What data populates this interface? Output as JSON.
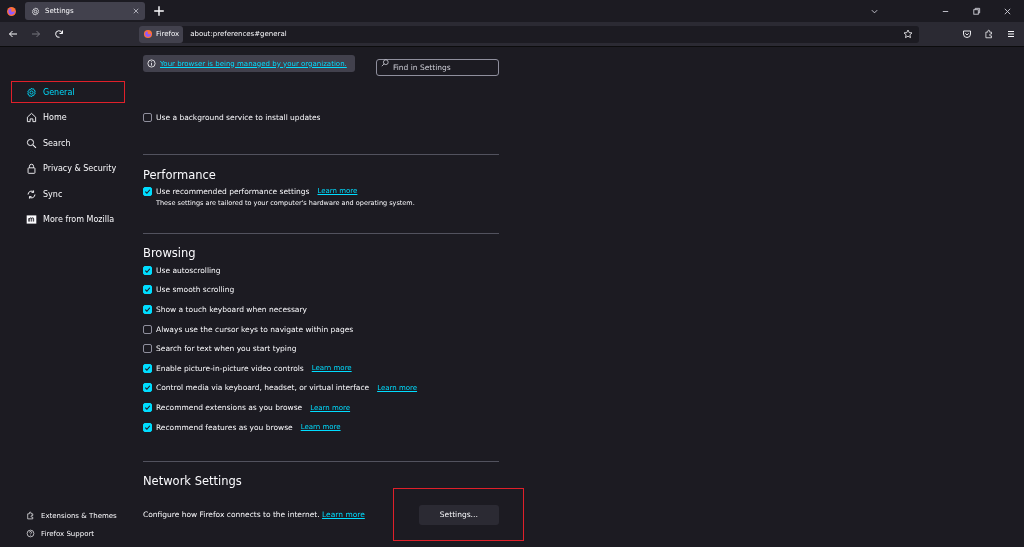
{
  "browser": {
    "tab": {
      "title": "Settings",
      "selected": true
    },
    "identity_label": "Firefox",
    "url": "about:preferences#general"
  },
  "sidebar": {
    "items": [
      {
        "label": "General",
        "selected": true,
        "highlighted": true
      },
      {
        "label": "Home",
        "selected": false,
        "highlighted": false
      },
      {
        "label": "Search",
        "selected": false,
        "highlighted": false
      },
      {
        "label": "Privacy & Security",
        "selected": false,
        "highlighted": false
      },
      {
        "label": "Sync",
        "selected": false,
        "highlighted": false
      },
      {
        "label": "More from Mozilla",
        "selected": false,
        "highlighted": false
      }
    ],
    "footer": [
      {
        "label": "Extensions & Themes"
      },
      {
        "label": "Firefox Support"
      }
    ]
  },
  "notice": "Your browser is being managed by your organization.",
  "search": {
    "placeholder": "Find in Settings"
  },
  "update_option": {
    "label": "Use a background service to install updates",
    "checked": false
  },
  "sections": [
    {
      "title": "Performance",
      "options": [
        {
          "label": "Use recommended performance settings",
          "checked": true,
          "link": "Learn more"
        }
      ],
      "note": "These settings are tailored to your computer's hardware and operating system."
    },
    {
      "title": "Browsing",
      "options": [
        {
          "label": "Use autoscrolling",
          "checked": true
        },
        {
          "label": "Use smooth scrolling",
          "checked": true
        },
        {
          "label": "Show a touch keyboard when necessary",
          "checked": true
        },
        {
          "label": "Always use the cursor keys to navigate within pages",
          "checked": false
        },
        {
          "label": "Search for text when you start typing",
          "checked": false
        },
        {
          "label": "Enable picture-in-picture video controls",
          "checked": true,
          "link": "Learn more"
        },
        {
          "label": "Control media via keyboard, headset, or virtual interface",
          "checked": true,
          "link": "Learn more"
        },
        {
          "label": "Recommend extensions as you browse",
          "checked": true,
          "link": "Learn more"
        },
        {
          "label": "Recommend features as you browse",
          "checked": true,
          "link": "Learn more"
        }
      ]
    }
  ],
  "network": {
    "title": "Network Settings",
    "description": "Configure how Firefox connects to the internet.",
    "link": "Learn more",
    "button": "Settings…",
    "highlighted": true
  }
}
